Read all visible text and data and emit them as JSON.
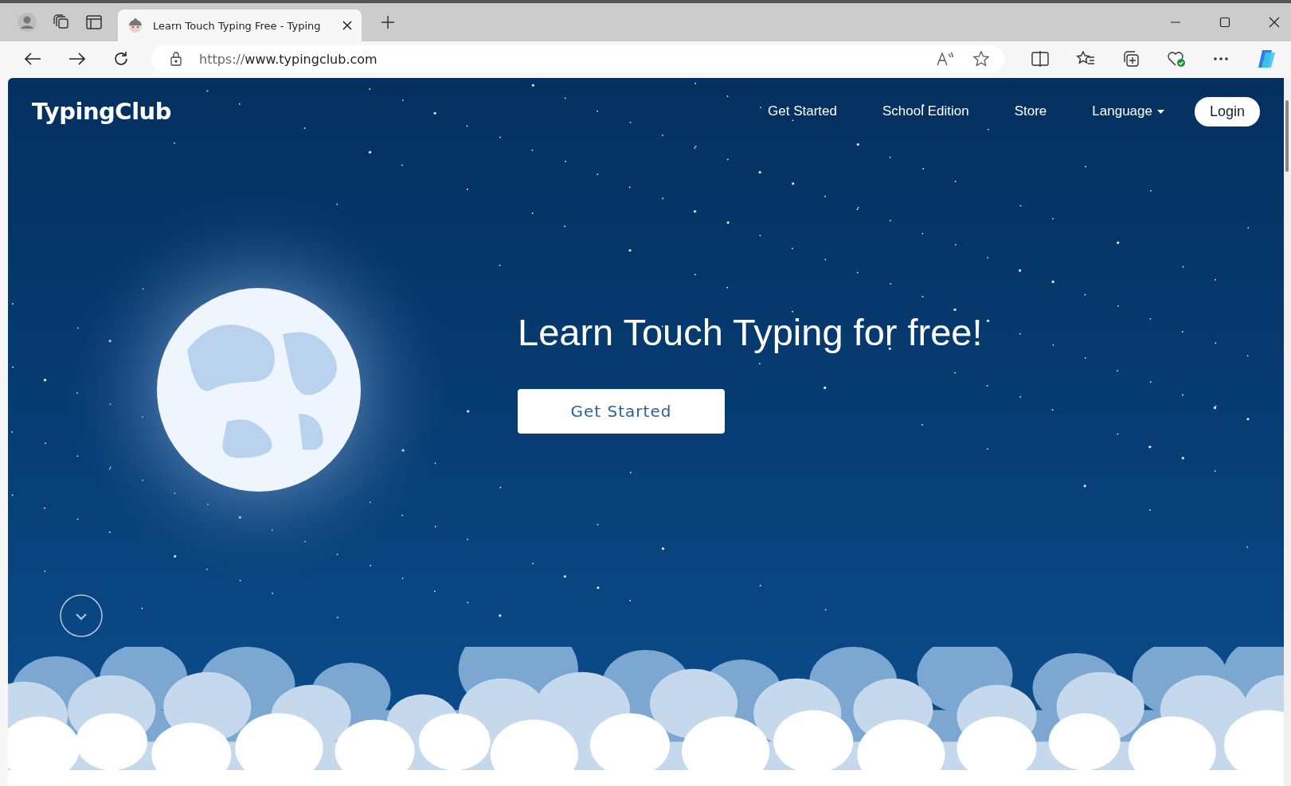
{
  "browser": {
    "tab": {
      "title": "Learn Touch Typing Free - Typing",
      "selected": true
    },
    "url_scheme": "https://",
    "url_host": "www.typingclub.com"
  },
  "site": {
    "logo": "TypingClub",
    "nav": [
      {
        "label": "Get Started",
        "kind": "link"
      },
      {
        "label": "School Edition",
        "kind": "link"
      },
      {
        "label": "Store",
        "kind": "link"
      },
      {
        "label": "Language",
        "kind": "dropdown"
      }
    ],
    "login": "Login"
  },
  "hero": {
    "headline": "Learn Touch Typing for free!",
    "cta": "Get Started"
  }
}
